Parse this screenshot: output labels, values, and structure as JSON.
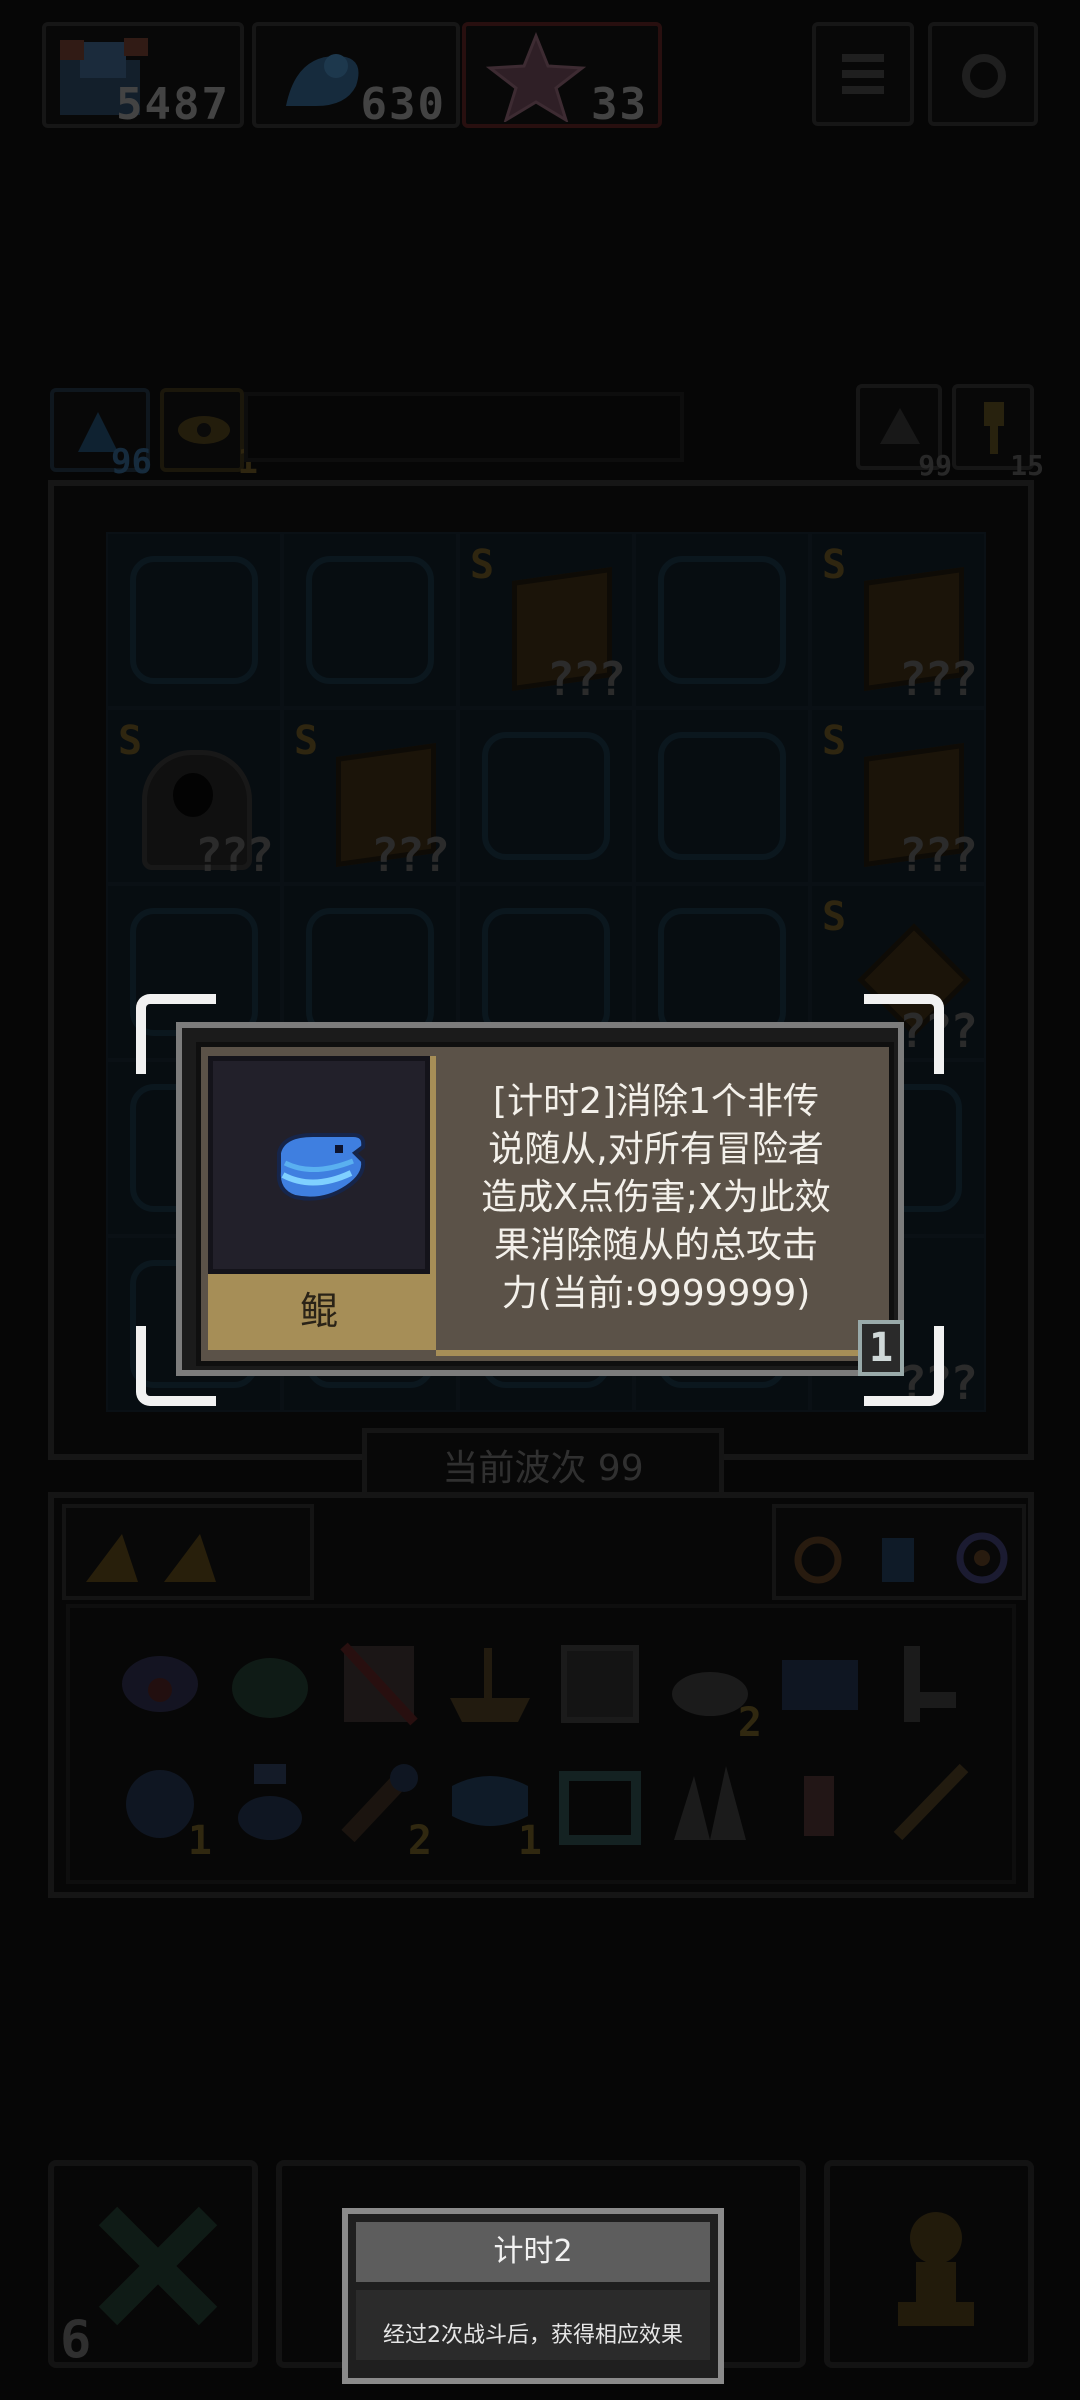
{
  "resources": {
    "gold": "5487",
    "gems": "630",
    "stars": "33"
  },
  "status_row": {
    "left_count": "96",
    "eye_count": "1",
    "right1_count": "99",
    "right2_count": "15"
  },
  "board": {
    "unknown_label": "???",
    "rank_label": "S"
  },
  "wave": {
    "label": "当前波次 99"
  },
  "inventory": {
    "counts": [
      "2",
      "1",
      "2",
      "1"
    ]
  },
  "tooltip": {
    "item_name": "鲲",
    "description": "[计时2]消除1个非传\n说随从,对所有冒险者\n造成X点伤害;X为此效\n果消除随从的总攻击\n力(当前:9999999)",
    "level": "1"
  },
  "bottom": {
    "left_count": "6"
  },
  "popup": {
    "title": "计时2",
    "body": "经过2次战斗后，获得相应效果"
  },
  "colors": {
    "accent_gold": "#a68e57",
    "tooltip_bg": "#5b5248",
    "whale_blue": "#3f7fe0"
  }
}
